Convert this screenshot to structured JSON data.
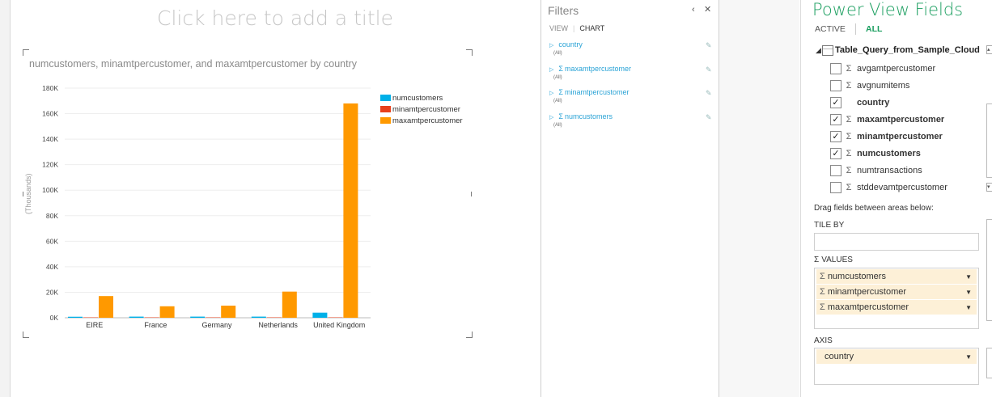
{
  "report": {
    "title_placeholder": "Click here to add a title"
  },
  "chart_data": {
    "type": "bar",
    "title": "numcustomers, minamtpercustomer, and maxamtpercustomer by country",
    "ylabel": "(Thousands)",
    "categories": [
      "EIRE",
      "France",
      "Germany",
      "Netherlands",
      "United Kingdom"
    ],
    "ylim": [
      0,
      180000
    ],
    "yticks": [
      0,
      20000,
      40000,
      60000,
      80000,
      100000,
      120000,
      140000,
      160000,
      180000
    ],
    "ytick_labels": [
      "0K",
      "20K",
      "40K",
      "60K",
      "80K",
      "100K",
      "120K",
      "140K",
      "160K",
      "180K"
    ],
    "grid": true,
    "legend_position": "top-right",
    "series": [
      {
        "name": "numcustomers",
        "color": "#00b0e8",
        "values": [
          800,
          900,
          900,
          900,
          4000
        ]
      },
      {
        "name": "minamtpercustomer",
        "color": "#e8401c",
        "values": [
          300,
          300,
          300,
          300,
          300
        ]
      },
      {
        "name": "maxamtpercustomer",
        "color": "#ff9900",
        "values": [
          17000,
          9000,
          9500,
          20500,
          168000
        ]
      }
    ]
  },
  "filters": {
    "title": "Filters",
    "tabs": [
      "VIEW",
      "CHART"
    ],
    "items": [
      {
        "label": "country",
        "value": "(All)",
        "sigma": false
      },
      {
        "label": "maxamtpercustomer",
        "value": "(All)",
        "sigma": true
      },
      {
        "label": "minamtpercustomer",
        "value": "(All)",
        "sigma": true
      },
      {
        "label": "numcustomers",
        "value": "(All)",
        "sigma": true
      }
    ]
  },
  "fields": {
    "title": "Power View Fields",
    "tab_active": "ACTIVE",
    "tab_all": "ALL",
    "table_name": "Table_Query_from_Sample_Cloud",
    "items": [
      {
        "label": "avgamtpercustomer",
        "checked": false,
        "sigma": true
      },
      {
        "label": "avgnumitems",
        "checked": false,
        "sigma": true
      },
      {
        "label": "country",
        "checked": true,
        "sigma": false
      },
      {
        "label": "maxamtpercustomer",
        "checked": true,
        "sigma": true
      },
      {
        "label": "minamtpercustomer",
        "checked": true,
        "sigma": true
      },
      {
        "label": "numcustomers",
        "checked": true,
        "sigma": true
      },
      {
        "label": "numtransactions",
        "checked": false,
        "sigma": true
      },
      {
        "label": "stddevamtpercustomer",
        "checked": false,
        "sigma": true
      }
    ],
    "drag_hint": "Drag fields between areas below:",
    "tile_by_label": "TILE BY",
    "values_label": "VALUES",
    "values_items": [
      "numcustomers",
      "minamtpercustomer",
      "maxamtpercustomer"
    ],
    "axis_label": "AXIS",
    "axis_items": [
      "country"
    ]
  }
}
